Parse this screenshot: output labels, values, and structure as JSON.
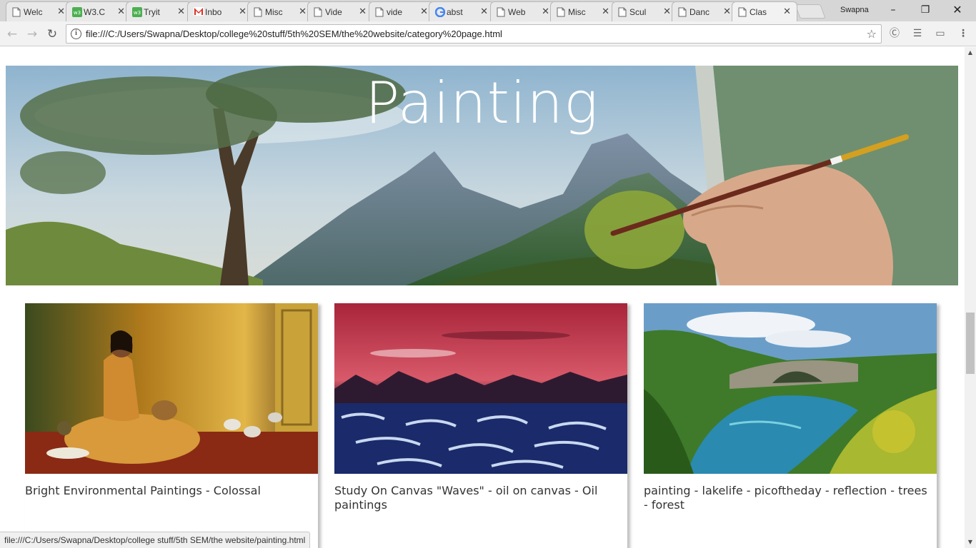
{
  "browser": {
    "tabs": [
      {
        "label": "Welc",
        "icon": "page-icon"
      },
      {
        "label": "W3.C",
        "icon": "w3schools-icon"
      },
      {
        "label": "Tryit",
        "icon": "w3schools-icon"
      },
      {
        "label": "Inbo",
        "icon": "gmail-icon"
      },
      {
        "label": "Misc",
        "icon": "page-icon"
      },
      {
        "label": "Vide",
        "icon": "page-icon"
      },
      {
        "label": "vide",
        "icon": "page-icon"
      },
      {
        "label": "abst",
        "icon": "google-icon"
      },
      {
        "label": "Web",
        "icon": "page-icon"
      },
      {
        "label": "Misc",
        "icon": "page-icon"
      },
      {
        "label": "Scul",
        "icon": "page-icon"
      },
      {
        "label": "Danc",
        "icon": "page-icon"
      },
      {
        "label": "Clas",
        "icon": "page-icon",
        "active": true
      }
    ],
    "user_name": "Swapna",
    "url": "file:///C:/Users/Swapna/Desktop/college%20stuff/5th%20SEM/the%20website/category%20page.html",
    "status_url": "file:///C:/Users/Swapna/Desktop/college stuff/5th SEM/the website/painting.html"
  },
  "page": {
    "hero_title": "Painting",
    "cards": [
      {
        "caption": "Bright Environmental Paintings - Colossal",
        "image": "woman-with-pigeons-painting"
      },
      {
        "caption": "Study On Canvas \"Waves\" - oil on canvas - Oil paintings",
        "image": "red-sky-waves-painting"
      },
      {
        "caption": "painting - lakelife - picoftheday - reflection - trees - forest",
        "image": "stone-bridge-lake-painting"
      }
    ]
  },
  "colors": {
    "tab_strip": "#d6d6d6",
    "toolbar": "#f2f2f2",
    "caption_text": "#333333"
  }
}
